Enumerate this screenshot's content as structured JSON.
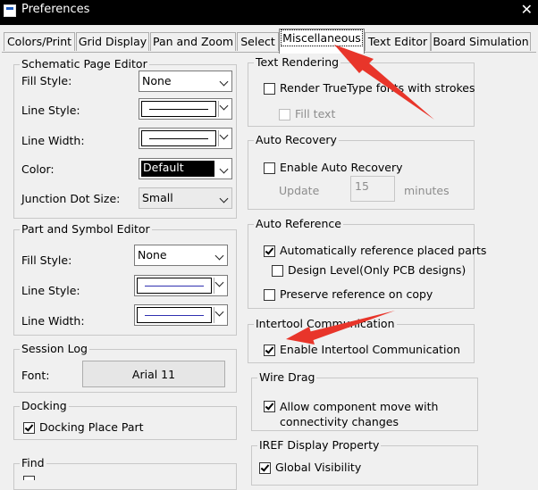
{
  "window": {
    "title": "Preferences",
    "close_glyph": "✕"
  },
  "tabs": [
    {
      "label": "Colors/Print"
    },
    {
      "label": "Grid Display"
    },
    {
      "label": "Pan and Zoom"
    },
    {
      "label": "Select"
    },
    {
      "label": "Miscellaneous",
      "active": true
    },
    {
      "label": "Text Editor"
    },
    {
      "label": "Board Simulation"
    }
  ],
  "schematic": {
    "title": "Schematic Page Editor",
    "fill_style": {
      "label": "Fill Style:",
      "value": "None"
    },
    "line_style": {
      "label": "Line Style:"
    },
    "line_width": {
      "label": "Line Width:"
    },
    "color": {
      "label": "Color:",
      "value": "Default"
    },
    "junction": {
      "label": "Junction Dot Size:",
      "value": "Small"
    }
  },
  "part_symbol": {
    "title": "Part and Symbol Editor",
    "fill_style": {
      "label": "Fill Style:",
      "value": "None"
    },
    "line_style": {
      "label": "Line Style:"
    },
    "line_width": {
      "label": "Line Width:"
    }
  },
  "session_log": {
    "title": "Session Log",
    "font_label": "Font:",
    "font_value": "Arial 11"
  },
  "docking": {
    "title": "Docking",
    "docking_place_part": "Docking Place Part",
    "checked": true
  },
  "find": {
    "title": "Find"
  },
  "text_rendering": {
    "title": "Text Rendering",
    "render_truetype": "Render TrueType fonts with strokes",
    "fill_text": "Fill text"
  },
  "auto_recovery": {
    "title": "Auto Recovery",
    "enable": "Enable Auto Recovery",
    "update_label": "Update",
    "update_value": "15",
    "minutes": "minutes"
  },
  "auto_reference": {
    "title": "Auto Reference",
    "auto_ref": "Automatically reference placed parts",
    "design_level": "Design Level(Only PCB designs)",
    "preserve": "Preserve reference on copy"
  },
  "intertool": {
    "title": "Intertool Communication",
    "enable": "Enable Intertool Communication"
  },
  "wire_drag": {
    "title": "Wire Drag",
    "allow_line1": "Allow component move with",
    "allow_line2": "connectivity changes"
  },
  "iref": {
    "title": "IREF Display Property",
    "global_visibility": "Global Visibility"
  },
  "colors": {
    "annotation_arrow": "#e8352a",
    "accent_black": "#000000"
  }
}
